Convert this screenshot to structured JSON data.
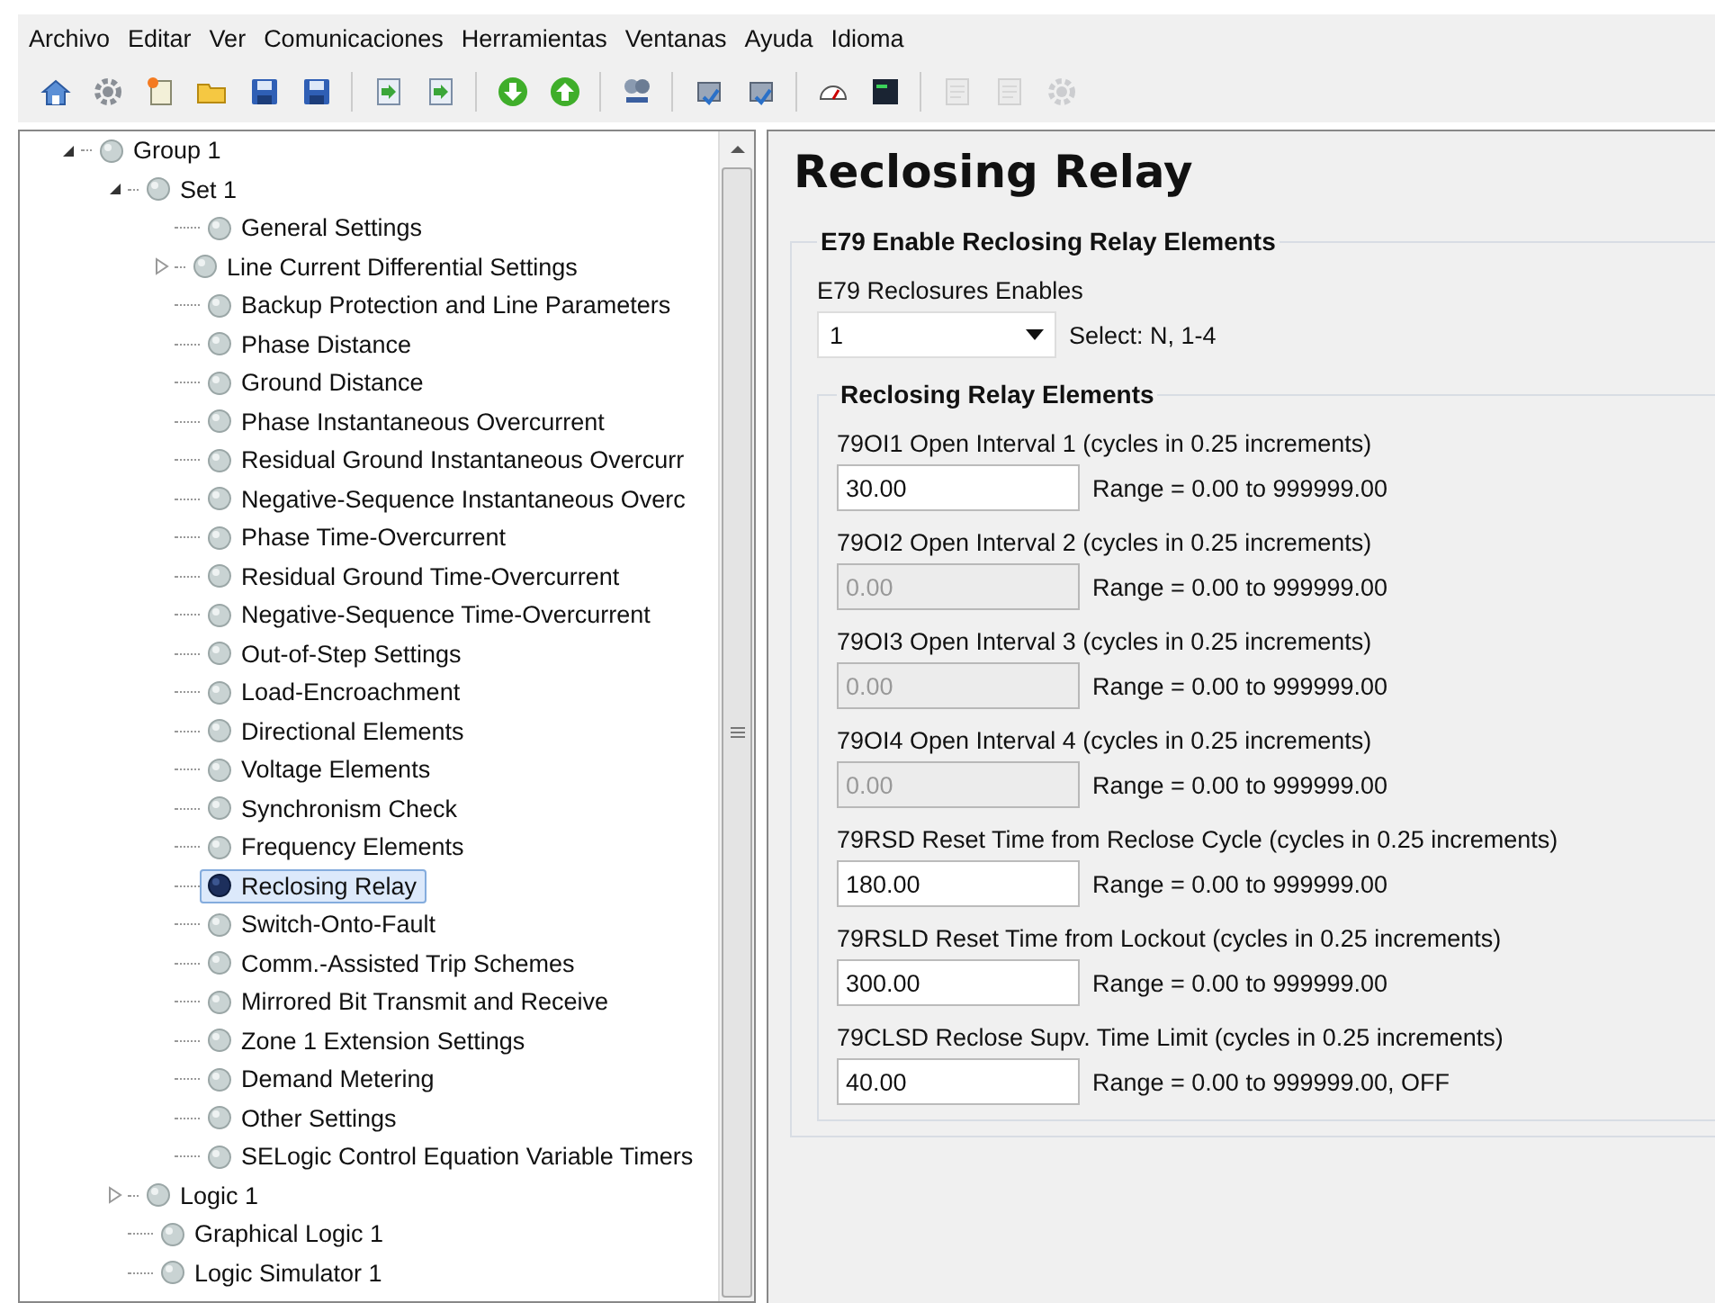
{
  "menu": [
    "Archivo",
    "Editar",
    "Ver",
    "Comunicaciones",
    "Herramientas",
    "Ventanas",
    "Ayuda",
    "Idioma"
  ],
  "toolbar": [
    [
      {
        "disabled": false
      },
      {
        "disabled": false
      },
      {
        "disabled": false
      },
      {
        "disabled": false
      },
      {
        "disabled": false
      },
      {
        "disabled": false
      }
    ],
    [
      {
        "disabled": false
      },
      {
        "disabled": false
      }
    ],
    [
      {
        "disabled": false
      },
      {
        "disabled": false
      }
    ],
    [
      {
        "disabled": false
      }
    ],
    [
      {
        "disabled": false
      },
      {
        "disabled": false
      }
    ],
    [
      {
        "disabled": false
      },
      {
        "disabled": false
      }
    ],
    [
      {
        "disabled": true
      },
      {
        "disabled": true
      },
      {
        "disabled": true
      }
    ]
  ],
  "tree": [
    {
      "label": "Group 1",
      "expanded": true,
      "selected": false,
      "children": [
        {
          "label": "Set 1",
          "expanded": true,
          "selected": false,
          "children": [
            {
              "label": "General Settings",
              "selected": false
            },
            {
              "label": "Line Current Differential Settings",
              "expanded": false,
              "selected": false
            },
            {
              "label": "Backup Protection and Line Parameters",
              "selected": false
            },
            {
              "label": "Phase Distance",
              "selected": false
            },
            {
              "label": "Ground Distance",
              "selected": false
            },
            {
              "label": "Phase Instantaneous Overcurrent",
              "selected": false
            },
            {
              "label": "Residual Ground Instantaneous Overcurr",
              "selected": false
            },
            {
              "label": "Negative-Sequence Instantaneous Overc",
              "selected": false
            },
            {
              "label": "Phase Time-Overcurrent",
              "selected": false
            },
            {
              "label": "Residual Ground Time-Overcurrent",
              "selected": false
            },
            {
              "label": "Negative-Sequence Time-Overcurrent",
              "selected": false
            },
            {
              "label": "Out-of-Step Settings",
              "selected": false
            },
            {
              "label": "Load-Encroachment",
              "selected": false
            },
            {
              "label": "Directional Elements",
              "selected": false
            },
            {
              "label": "Voltage Elements",
              "selected": false
            },
            {
              "label": "Synchronism Check",
              "selected": false
            },
            {
              "label": "Frequency Elements",
              "selected": false
            },
            {
              "label": "Reclosing Relay",
              "selected": true
            },
            {
              "label": "Switch-Onto-Fault",
              "selected": false
            },
            {
              "label": "Comm.-Assisted Trip Schemes",
              "selected": false
            },
            {
              "label": "Mirrored Bit Transmit and Receive",
              "selected": false
            },
            {
              "label": "Zone 1 Extension Settings",
              "selected": false
            },
            {
              "label": "Demand Metering",
              "selected": false
            },
            {
              "label": "Other Settings",
              "selected": false
            },
            {
              "label": "SELogic Control Equation Variable Timers",
              "selected": false
            }
          ]
        },
        {
          "label": "Logic 1",
          "expanded": false,
          "selected": false
        },
        {
          "label": "Graphical Logic 1",
          "selected": false
        },
        {
          "label": "Logic Simulator 1",
          "selected": false
        }
      ]
    }
  ],
  "page": {
    "title": "Reclosing Relay",
    "enable_group": {
      "title": "E79 Enable Reclosing Relay Elements",
      "label": "E79  Reclosures Enables",
      "value": "1",
      "hint": "Select: N, 1-4"
    },
    "elements_group": {
      "title": "Reclosing Relay Elements",
      "fields": [
        {
          "label": "79OI1  Open Interval 1 (cycles in 0.25 increments)",
          "value": "30.00",
          "range": "Range = 0.00 to 999999.00",
          "disabled": false
        },
        {
          "label": "79OI2  Open Interval 2 (cycles in 0.25 increments)",
          "value": "0.00",
          "range": "Range = 0.00 to 999999.00",
          "disabled": true
        },
        {
          "label": "79OI3  Open Interval 3 (cycles in 0.25 increments)",
          "value": "0.00",
          "range": "Range = 0.00 to 999999.00",
          "disabled": true
        },
        {
          "label": "79OI4  Open Interval 4 (cycles in 0.25 increments)",
          "value": "0.00",
          "range": "Range = 0.00 to 999999.00",
          "disabled": true
        },
        {
          "label": "79RSD  Reset Time from Reclose Cycle (cycles in 0.25 increments)",
          "value": "180.00",
          "range": "Range = 0.00 to 999999.00",
          "disabled": false
        },
        {
          "label": "79RSLD  Reset Time from Lockout (cycles in 0.25 increments)",
          "value": "300.00",
          "range": "Range = 0.00 to 999999.00",
          "disabled": false
        },
        {
          "label": "79CLSD  Reclose Supv. Time Limit (cycles in 0.25 increments)",
          "value": "40.00",
          "range": "Range = 0.00 to 999999.00, OFF",
          "disabled": false
        }
      ]
    }
  }
}
